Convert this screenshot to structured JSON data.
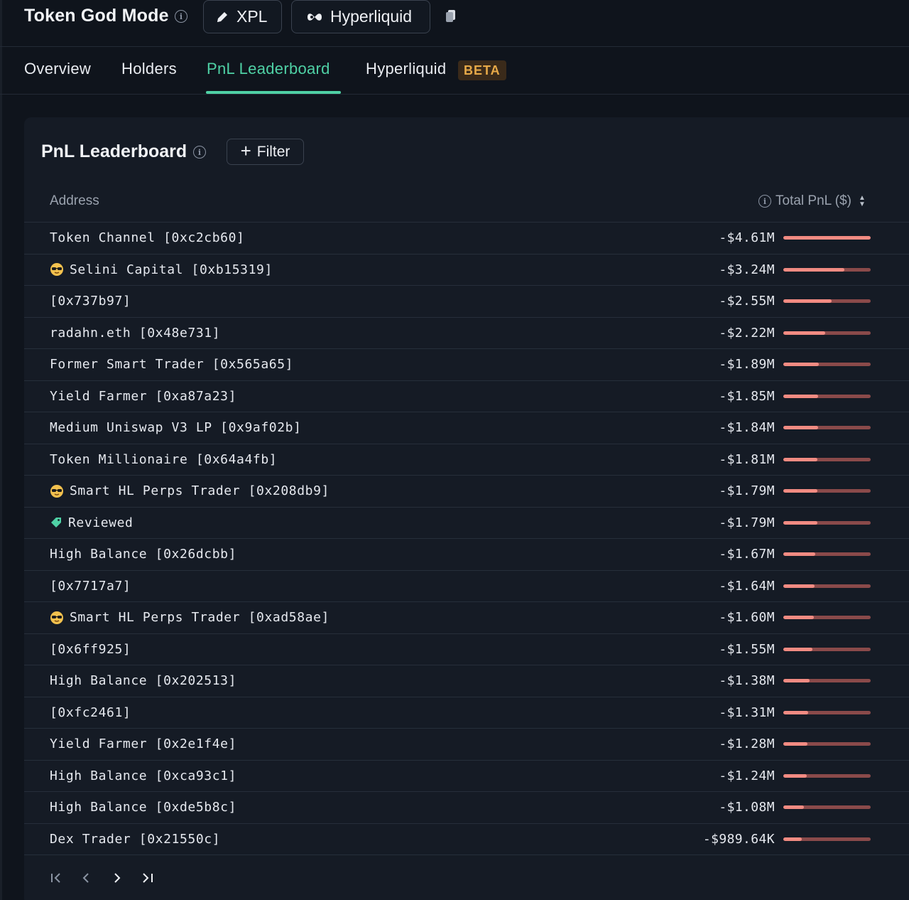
{
  "header": {
    "title": "Token God Mode",
    "token_label": "XPL",
    "chain_label": "Hyperliquid"
  },
  "tabs": [
    {
      "label": "Overview"
    },
    {
      "label": "Holders"
    },
    {
      "label": "PnL Leaderboard",
      "active": true
    },
    {
      "label": "Hyperliquid",
      "badge": "BETA"
    }
  ],
  "panel": {
    "title": "PnL Leaderboard",
    "filter_label": "Filter",
    "columns": {
      "address": "Address",
      "pnl": "Total PnL ($)"
    }
  },
  "rows": [
    {
      "label": "Token Channel [0xc2cb60]",
      "value": "-$4.61M",
      "pnl": -4610000
    },
    {
      "label": "Selini Capital [0xb15319]",
      "icon": "sunglasses-emoji-icon",
      "value": "-$3.24M",
      "pnl": -3240000
    },
    {
      "label": "[0x737b97]",
      "value": "-$2.55M",
      "pnl": -2550000
    },
    {
      "label": "radahn.eth [0x48e731]",
      "value": "-$2.22M",
      "pnl": -2220000
    },
    {
      "label": "Former Smart Trader [0x565a65]",
      "value": "-$1.89M",
      "pnl": -1890000
    },
    {
      "label": "Yield Farmer [0xa87a23]",
      "value": "-$1.85M",
      "pnl": -1850000
    },
    {
      "label": "Medium Uniswap V3 LP [0x9af02b]",
      "value": "-$1.84M",
      "pnl": -1840000
    },
    {
      "label": "Token Millionaire [0x64a4fb]",
      "value": "-$1.81M",
      "pnl": -1810000
    },
    {
      "label": "Smart HL Perps Trader [0x208db9]",
      "icon": "sunglasses-emoji-icon",
      "value": "-$1.79M",
      "pnl": -1790000
    },
    {
      "label": "Reviewed",
      "icon": "tag-icon",
      "value": "-$1.79M",
      "pnl": -1790000
    },
    {
      "label": "High Balance [0x26dcbb]",
      "value": "-$1.67M",
      "pnl": -1670000
    },
    {
      "label": "[0x7717a7]",
      "value": "-$1.64M",
      "pnl": -1640000
    },
    {
      "label": "Smart HL Perps Trader [0xad58ae]",
      "icon": "sunglasses-emoji-icon",
      "value": "-$1.60M",
      "pnl": -1600000
    },
    {
      "label": "[0x6ff925]",
      "value": "-$1.55M",
      "pnl": -1550000
    },
    {
      "label": "High Balance [0x202513]",
      "value": "-$1.38M",
      "pnl": -1380000
    },
    {
      "label": "[0xfc2461]",
      "value": "-$1.31M",
      "pnl": -1310000
    },
    {
      "label": "Yield Farmer [0x2e1f4e]",
      "value": "-$1.28M",
      "pnl": -1280000
    },
    {
      "label": "High Balance [0xca93c1]",
      "value": "-$1.24M",
      "pnl": -1240000
    },
    {
      "label": "High Balance [0xde5b8c]",
      "value": "-$1.08M",
      "pnl": -1080000
    },
    {
      "label": "Dex Trader [0x21550c]",
      "value": "-$989.64K",
      "pnl": -989640
    }
  ],
  "colors": {
    "accent": "#4fd1a5",
    "bar_fill": "#f28b82",
    "bar_track": "#8a4a4a",
    "beta_text": "#e7a948"
  }
}
